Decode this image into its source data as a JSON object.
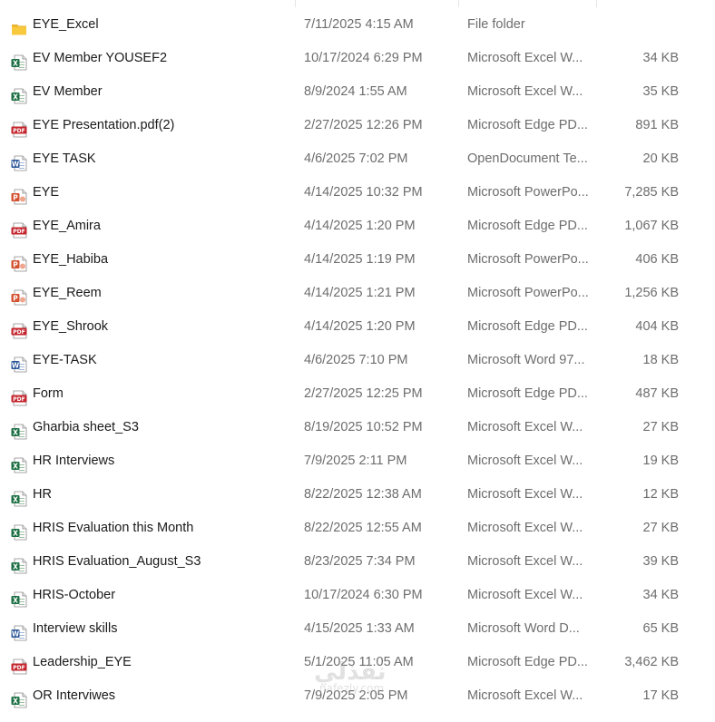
{
  "files": [
    {
      "name": "EYE_Excel",
      "date": "7/11/2025 4:15 AM",
      "type": "File folder",
      "size": "",
      "icon": "folder-icon"
    },
    {
      "name": "EV Member YOUSEF2",
      "date": "10/17/2024 6:29 PM",
      "type": "Microsoft Excel W...",
      "size": "34 KB",
      "icon": "excel-icon"
    },
    {
      "name": "EV Member",
      "date": "8/9/2024 1:55 AM",
      "type": "Microsoft Excel W...",
      "size": "35 KB",
      "icon": "excel-icon"
    },
    {
      "name": "EYE Presentation.pdf(2)",
      "date": "2/27/2025 12:26 PM",
      "type": "Microsoft Edge PD...",
      "size": "891 KB",
      "icon": "pdf-icon"
    },
    {
      "name": "EYE TASK",
      "date": "4/6/2025 7:02 PM",
      "type": "OpenDocument Te...",
      "size": "20 KB",
      "icon": "word-icon"
    },
    {
      "name": "EYE",
      "date": "4/14/2025 10:32 PM",
      "type": "Microsoft PowerPo...",
      "size": "7,285 KB",
      "icon": "powerpoint-icon"
    },
    {
      "name": "EYE_Amira",
      "date": "4/14/2025 1:20 PM",
      "type": "Microsoft Edge PD...",
      "size": "1,067 KB",
      "icon": "pdf-icon"
    },
    {
      "name": "EYE_Habiba",
      "date": "4/14/2025 1:19 PM",
      "type": "Microsoft PowerPo...",
      "size": "406 KB",
      "icon": "powerpoint-icon"
    },
    {
      "name": "EYE_Reem",
      "date": "4/14/2025 1:21 PM",
      "type": "Microsoft PowerPo...",
      "size": "1,256 KB",
      "icon": "powerpoint-icon"
    },
    {
      "name": "EYE_Shrook",
      "date": "4/14/2025 1:20 PM",
      "type": "Microsoft Edge PD...",
      "size": "404 KB",
      "icon": "pdf-icon"
    },
    {
      "name": "EYE-TASK",
      "date": "4/6/2025 7:10 PM",
      "type": "Microsoft Word 97...",
      "size": "18 KB",
      "icon": "word-icon"
    },
    {
      "name": "Form",
      "date": "2/27/2025 12:25 PM",
      "type": "Microsoft Edge PD...",
      "size": "487 KB",
      "icon": "pdf-icon"
    },
    {
      "name": "Gharbia sheet_S3",
      "date": "8/19/2025 10:52 PM",
      "type": "Microsoft Excel W...",
      "size": "27 KB",
      "icon": "excel-icon"
    },
    {
      "name": "HR Interviews",
      "date": "7/9/2025 2:11 PM",
      "type": "Microsoft Excel W...",
      "size": "19 KB",
      "icon": "excel-icon"
    },
    {
      "name": "HR",
      "date": "8/22/2025 12:38 AM",
      "type": "Microsoft Excel W...",
      "size": "12 KB",
      "icon": "excel-icon"
    },
    {
      "name": "HRIS Evaluation this Month",
      "date": "8/22/2025 12:55 AM",
      "type": "Microsoft Excel W...",
      "size": "27 KB",
      "icon": "excel-icon"
    },
    {
      "name": "HRIS Evaluation_August_S3",
      "date": "8/23/2025 7:34 PM",
      "type": "Microsoft Excel W...",
      "size": "39 KB",
      "icon": "excel-icon"
    },
    {
      "name": "HRIS-October",
      "date": "10/17/2024 6:30 PM",
      "type": "Microsoft Excel W...",
      "size": "34 KB",
      "icon": "excel-icon"
    },
    {
      "name": "Interview skills",
      "date": "4/15/2025 1:33 AM",
      "type": "Microsoft Word D...",
      "size": "65 KB",
      "icon": "word-icon"
    },
    {
      "name": "Leadership_EYE",
      "date": "5/1/2025 11:05 AM",
      "type": "Microsoft Edge PD...",
      "size": "3,462 KB",
      "icon": "pdf-icon"
    },
    {
      "name": "OR Interviwes",
      "date": "7/9/2025 2:05 PM",
      "type": "Microsoft Excel W...",
      "size": "17 KB",
      "icon": "excel-icon"
    }
  ],
  "watermark": {
    "arabic": "نفذلي",
    "latin": "nafezly.com"
  },
  "colors": {
    "excel": "#1d7044",
    "pdf": "#c4262e",
    "word": "#2b5797",
    "powerpoint": "#d35230",
    "folder": "#f8c93d"
  }
}
